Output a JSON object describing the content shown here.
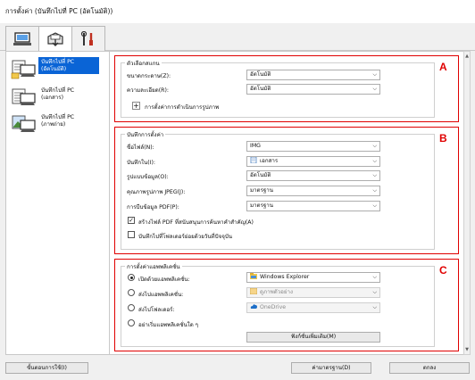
{
  "window": {
    "title": "การตั้งค่า (บันทึกไปที่ PC (อัตโนมัติ))"
  },
  "top_tabs": [
    {
      "icon": "scan-from-computer-icon"
    },
    {
      "icon": "scan-from-operation-panel-icon"
    },
    {
      "icon": "general-settings-icon"
    }
  ],
  "sidebar": {
    "items": [
      {
        "label": "บันทึกไปที่ PC (อัตโนมัติ)",
        "icon": "auto-scan-icon",
        "selected": true
      },
      {
        "label": "บันทึกไปที่ PC (เอกสาร)",
        "icon": "document-scan-icon"
      },
      {
        "label": "บันทึกไปที่ PC (ภาพถ่าย)",
        "icon": "photo-scan-icon"
      }
    ]
  },
  "section_a": {
    "letter": "A",
    "group_title": "ตัวเลือกสแกน",
    "paper_size_label": "ขนาดกระดาษ(Z):",
    "paper_size_value": "อัตโนมัติ",
    "resolution_label": "ความละเอียด(R):",
    "resolution_value": "อัตโนมัติ",
    "image_processing_label": "การตั้งค่าการดำเนินการรูปภาพ"
  },
  "section_b": {
    "letter": "B",
    "group_title": "บันทึกการตั้งค่า",
    "file_name_label": "ชื่อไฟล์(N):",
    "file_name_value": "IMG",
    "save_in_label": "บันทึกใน(I):",
    "save_in_value": "เอกสาร",
    "data_format_label": "รูปแบบข้อมูล(O):",
    "data_format_value": "อัตโนมัติ",
    "jpeg_quality_label": "คุณภาพรูปภาพ JPEG(J):",
    "jpeg_quality_value": "มาตรฐาน",
    "pdf_compression_label": "การบีบข้อมูล PDF(P):",
    "pdf_compression_value": "มาตรฐาน",
    "keyword_pdf_label": "สร้างไฟล์ PDF ที่สนับสนุนการค้นหาคำสำคัญ(A)",
    "keyword_pdf_checked": true,
    "subfolder_label": "บันทึกไปที่โฟลเดอร์ย่อยด้วยวันที่ปัจจุบัน",
    "subfolder_checked": false
  },
  "section_c": {
    "letter": "C",
    "group_title": "การตั้งค่าแอพพลิเคชั่น",
    "options": [
      {
        "label": "เปิดด้วยแอพพลิเคชั่น:",
        "value": "Windows Explorer",
        "selected": true,
        "enabled": true
      },
      {
        "label": "ส่งไปแอพพลิเคชั่น:",
        "value": "ดูภาพตัวอย่าง",
        "selected": false,
        "enabled": false
      },
      {
        "label": "ส่งไปโฟลเดอร์:",
        "value": "OneDrive",
        "selected": false,
        "enabled": false
      },
      {
        "label": "อย่าเริ่มแอพพลิเคชั่นใด ๆ",
        "selected": false
      }
    ],
    "more_functions_label": "ฟังก์ชั่นเพิ่มเติม(M)"
  },
  "bottom": {
    "instructions_label": "ขั้นตอนการใช้(I)",
    "defaults_label": "ค่ามาตรฐาน(D)",
    "ok_label": "ตกลง"
  },
  "colors": {
    "highlight": "#e00000",
    "selection": "#0a64d6"
  }
}
